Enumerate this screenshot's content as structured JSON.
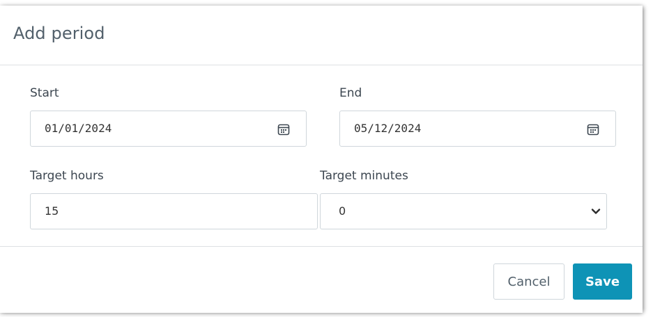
{
  "dialog": {
    "title": "Add period"
  },
  "form": {
    "start": {
      "label": "Start",
      "value": "01/01/2024"
    },
    "end": {
      "label": "End",
      "value": "05/12/2024"
    },
    "target_hours": {
      "label": "Target hours",
      "value": "15"
    },
    "target_minutes": {
      "label": "Target minutes",
      "value": "0"
    }
  },
  "footer": {
    "cancel_label": "Cancel",
    "save_label": "Save"
  },
  "colors": {
    "primary": "#0e93b6",
    "border": "#cfd6db",
    "title": "#52606b"
  },
  "icons": {
    "start_date": "calendar-icon",
    "end_date": "calendar-icon",
    "minutes_select": "chevron-down-icon"
  }
}
